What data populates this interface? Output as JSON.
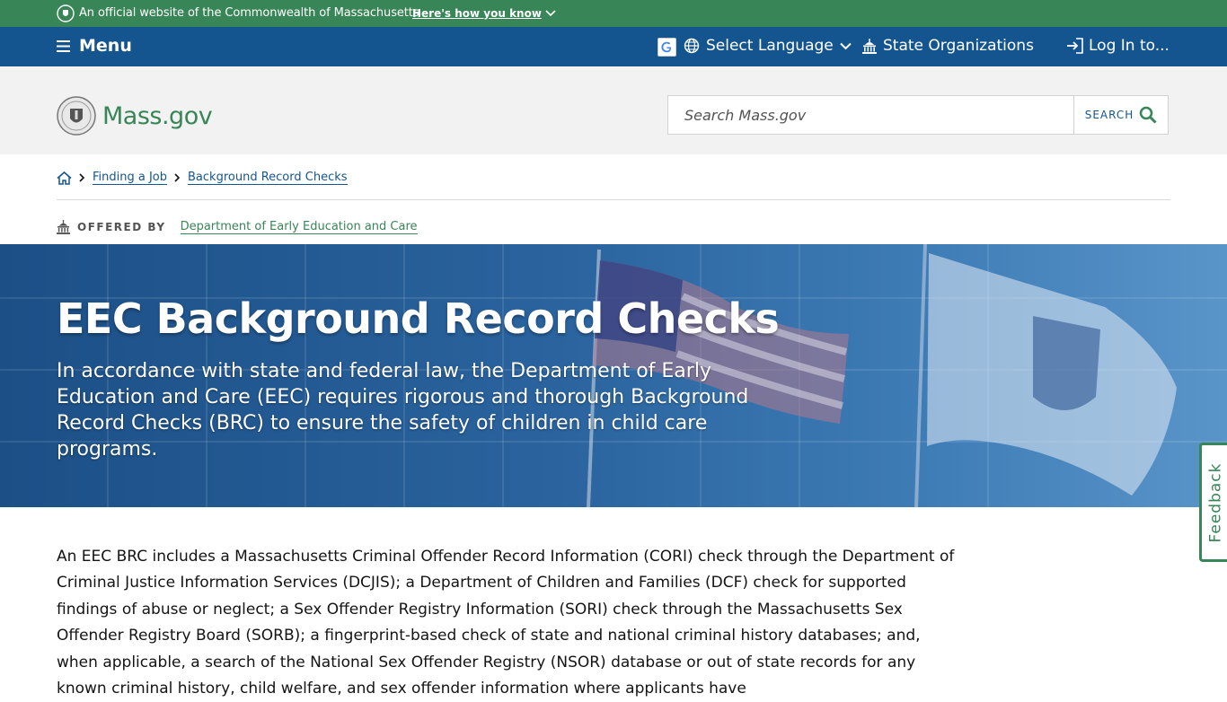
{
  "official_banner": {
    "text": "An official website of the Commonwealth of Massachusetts",
    "how_link": "Here's how you know"
  },
  "utility_nav": {
    "menu_label": "Menu",
    "language_label": "Select Language",
    "orgs_label": "State Organizations",
    "login_label": "Log In to..."
  },
  "header": {
    "logo_text": "Mass.gov",
    "search_placeholder": "Search Mass.gov",
    "search_button": "SEARCH"
  },
  "breadcrumb": {
    "items": [
      "Finding a Job",
      "Background Record Checks"
    ]
  },
  "offered_by": {
    "label": "OFFERED BY",
    "org": "Department of Early Education and Care"
  },
  "hero": {
    "title": "EEC Background Record Checks",
    "lead": "In accordance with state and federal law, the Department of Early Education and Care (EEC) requires rigorous and thorough Background Record Checks (BRC) to ensure the safety of children in child care programs."
  },
  "body": {
    "paragraph": "An EEC BRC includes a Massachusetts Criminal Offender Record Information (CORI) check through the Department of Criminal Justice Information Services (DCJIS); a Department of Children and Families (DCF) check for supported findings of abuse or neglect; a Sex Offender Registry Information (SORI) check through the Massachusetts Sex Offender Registry Board (SORB); a fingerprint-based check of state and national criminal history databases; and, when applicable, a search of the National Sex Offender Registry (NSOR) database or out of state records for any known criminal history, child welfare, and sex offender information where applicants have"
  },
  "feedback": {
    "label": "Feedback"
  },
  "colors": {
    "banner_green": "#388557",
    "nav_blue": "#14558f",
    "header_gray": "#f2f2f2"
  },
  "icons": {
    "seal": "massachusetts-seal-icon",
    "menu": "hamburger-icon",
    "globe": "globe-icon",
    "building": "capitol-building-icon",
    "login": "sign-in-icon",
    "search": "magnifier-icon",
    "home": "home-icon"
  }
}
